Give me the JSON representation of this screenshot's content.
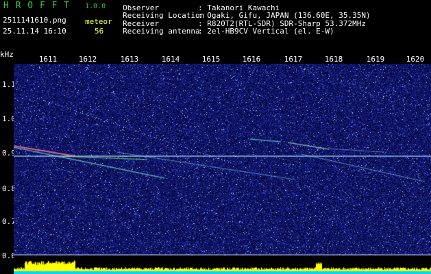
{
  "app": {
    "title": "H R O F F T",
    "version": "1.0.0",
    "image_label": "meteor"
  },
  "file": {
    "name": "2511141610.png",
    "datetime": "25.11.14 16:10",
    "count": "56"
  },
  "info": {
    "observer_label": "Observer",
    "observer_value": ": Takanori Kawachi",
    "location_label": "Receiving Location",
    "location_value": ": Ogaki, Gifu, JAPAN (136.60E, 35.35N)",
    "receiver_label": "Receiver",
    "receiver_value": ": R820T2(RTL-SDR) SDR-Sharp 53.372MHz",
    "antenna_label": "Receiving antenna",
    "antenna_value": ": 2el-HB9CV Vertical (el. E-W)"
  },
  "axes": {
    "y_unit": "kHz",
    "y_ticks": [
      "1.1",
      "1.0",
      "0.9",
      "0.8",
      "0.7",
      "0.6"
    ],
    "x_ticks": [
      "1611",
      "1612",
      "1613",
      "1614",
      "1615",
      "1616",
      "1617",
      "1618",
      "1619",
      "1620"
    ]
  },
  "colors": {
    "background": "#000000",
    "noise": "#1a2a8a",
    "signal_line": "#8fd0ff",
    "activity_bar": "#ffff00",
    "baseline": "#00d8ff"
  }
}
